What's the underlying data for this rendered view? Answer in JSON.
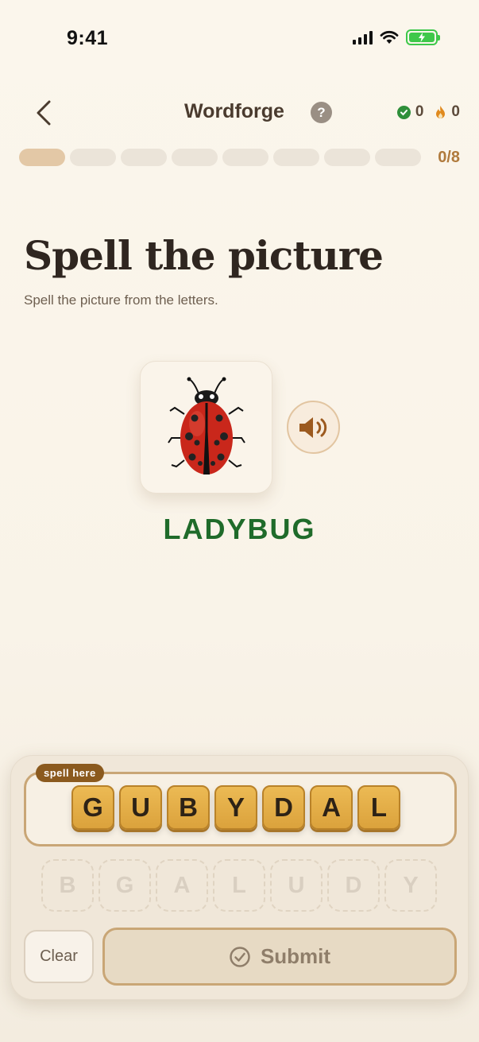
{
  "status_bar": {
    "time": "9:41"
  },
  "header": {
    "title": "Wordforge",
    "help_label": "?",
    "correct_count": "0",
    "streak_count": "0"
  },
  "progress": {
    "current": 0,
    "total": 8,
    "label": "0/8"
  },
  "prompt": {
    "title": "Spell the picture",
    "subtitle": "Spell the picture from the letters."
  },
  "picture": {
    "icon": "ladybug-icon",
    "word": "LADYBUG"
  },
  "spell_area": {
    "label": "spell here",
    "tiles": [
      "G",
      "U",
      "B",
      "Y",
      "D",
      "A",
      "L"
    ]
  },
  "letter_pool": [
    "B",
    "G",
    "A",
    "L",
    "U",
    "D",
    "Y"
  ],
  "actions": {
    "clear_label": "Clear",
    "submit_label": "Submit"
  },
  "colors": {
    "accent": "#b07a3c",
    "tile": "#dba23c",
    "word": "#1f6b2a",
    "badge": "#8b5a1e"
  }
}
